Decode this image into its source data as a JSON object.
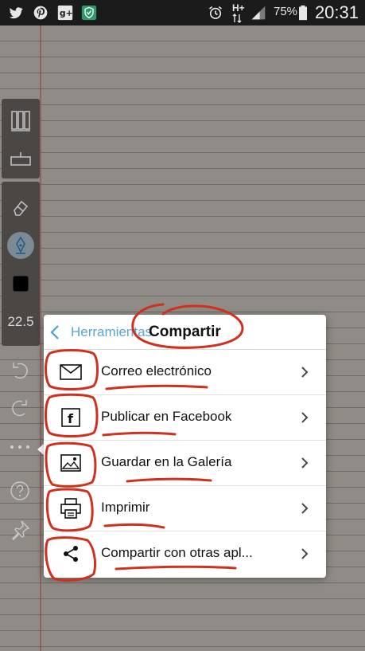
{
  "status_bar": {
    "left_icons": [
      "twitter-icon",
      "pinterest-icon",
      "google-plus-icon",
      "shield-app-icon"
    ],
    "network": "H+",
    "battery": "75%",
    "time": "20:31"
  },
  "toolbar": {
    "items": [
      "notebooks-icon",
      "ruler-icon",
      "eraser-icon",
      "pen-icon",
      "color-swatch",
      "size"
    ],
    "pen_size": "22.5",
    "floating": [
      "undo-icon",
      "redo-icon",
      "more-icon",
      "help-icon",
      "pin-icon"
    ]
  },
  "menu": {
    "back_label": "Herramientas",
    "title": "Compartir",
    "items": [
      {
        "label": "Correo electrónico",
        "icon": "mail-icon"
      },
      {
        "label": "Publicar en Facebook",
        "icon": "facebook-icon"
      },
      {
        "label": "Guardar en la Galería",
        "icon": "gallery-icon"
      },
      {
        "label": "Imprimir",
        "icon": "printer-icon"
      },
      {
        "label": "Compartir con otras apl...",
        "icon": "share-icon"
      }
    ]
  },
  "colors": {
    "accent": "#5aa6d1",
    "annotation": "#d0301e",
    "toolbar": "#4a4744",
    "paper": "#8f8b86"
  }
}
